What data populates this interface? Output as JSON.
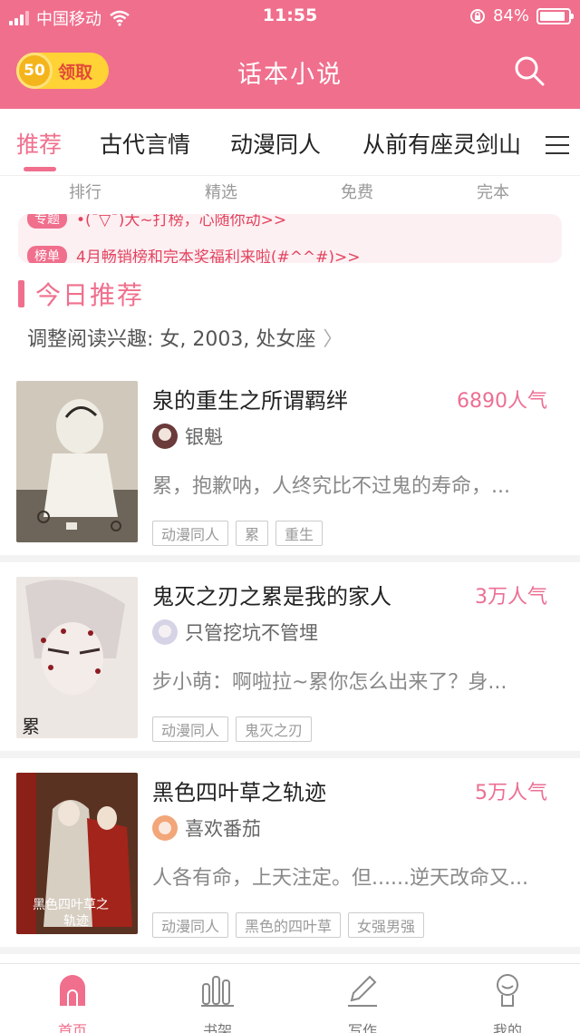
{
  "status_bar": {
    "carrier": "中国移动",
    "time": "11:55",
    "battery": "84%"
  },
  "header": {
    "claim_coins": "50",
    "claim_label": "领取",
    "title": "话本小说"
  },
  "category_tabs": [
    {
      "label": "推荐",
      "active": true
    },
    {
      "label": "古代言情",
      "active": false
    },
    {
      "label": "动漫同人",
      "active": false
    },
    {
      "label": "从前有座灵剑山",
      "active": false
    }
  ],
  "sub_nav": [
    "排行",
    "精选",
    "免费",
    "完本"
  ],
  "notices": [
    {
      "tag": "专题",
      "text": "•(¯▽¯)大~打榜，心随你动>>"
    },
    {
      "tag": "榜单",
      "text": "4月畅销榜和完本奖福利来啦(#^^#)>>"
    }
  ],
  "section": {
    "title": "今日推荐",
    "preference": "调整阅读兴趣: 女, 2003, 处女座"
  },
  "books": [
    {
      "title": "泉的重生之所谓羁绊",
      "popularity": "6890人气",
      "author": "银魁",
      "summary": "累，抱歉呐，人终究比不过鬼的寿命，...",
      "tags": [
        "动漫同人",
        "累",
        "重生"
      ]
    },
    {
      "title": "鬼灭之刃之累是我的家人",
      "popularity": "3万人气",
      "author": "只管挖坑不管埋",
      "summary": "步小萌：啊啦拉~累你怎么出来了？身...",
      "tags": [
        "动漫同人",
        "鬼灭之刃"
      ]
    },
    {
      "title": "黑色四叶草之轨迹",
      "popularity": "5万人气",
      "author": "喜欢番茄",
      "summary": "人各有命，上天注定。但......逆天改命又...",
      "tags": [
        "动漫同人",
        "黑色的四叶草",
        "女强男强"
      ]
    }
  ],
  "bottom_tabs": [
    {
      "label": "首页",
      "icon": "home-icon",
      "active": true
    },
    {
      "label": "书架",
      "icon": "bookshelf-icon",
      "active": false
    },
    {
      "label": "写作",
      "icon": "pencil-icon",
      "active": false
    },
    {
      "label": "我的",
      "icon": "profile-icon",
      "active": false
    }
  ],
  "colors": {
    "brand_pink": "#f06f8d",
    "popularity_pink": "#ec6f93",
    "coin_yellow": "#ffd236"
  }
}
